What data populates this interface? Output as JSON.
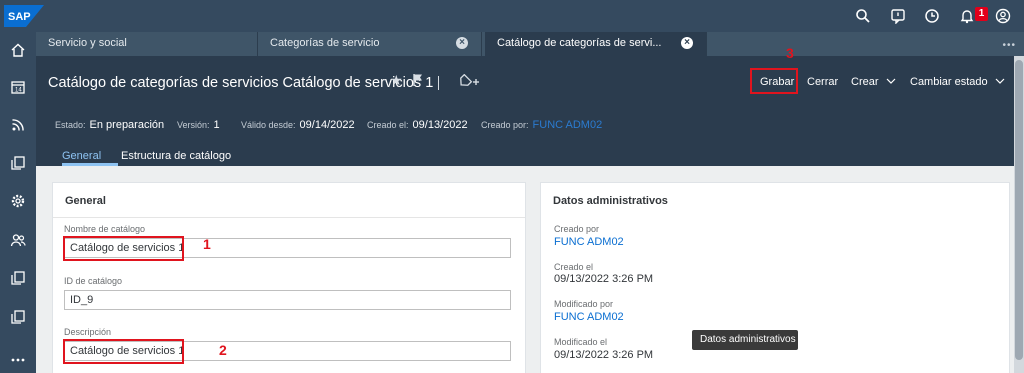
{
  "shell": {
    "logo_text": "SAP",
    "brand_color": "#0a6ed1",
    "icons": [
      "search-icon",
      "feedback-icon",
      "history-icon",
      "bell-icon",
      "user-icon"
    ],
    "notification_count": "1"
  },
  "sidenav": {
    "icons": [
      "home-icon",
      "calendar-icon",
      "feed-icon",
      "copy-icon",
      "settings-icon",
      "users-icon",
      "copy-icon",
      "copy-icon",
      "more-icon"
    ]
  },
  "tabs": [
    {
      "label": "Servicio y social"
    },
    {
      "label": "Categorías de servicio"
    },
    {
      "label": "Catálogo de categorías de servi..."
    }
  ],
  "header": {
    "title": "Catálogo de categorías de servicios Catálogo de servicios 1",
    "actions": {
      "save": "Grabar",
      "close": "Cerrar",
      "create": "Crear",
      "change_status": "Cambiar estado"
    },
    "meta": {
      "estado_label": "Estado:",
      "estado_value": "En preparación",
      "version_label": "Versión:",
      "version_value": "1",
      "valido_label": "Válido desde:",
      "valido_value": "09/14/2022",
      "creado_el_label": "Creado el:",
      "creado_el_value": "09/13/2022",
      "creado_por_label": "Creado por:",
      "creado_por_value": "FUNC ADM02"
    },
    "subtabs": [
      "General",
      "Estructura de catálogo"
    ]
  },
  "general": {
    "title": "General",
    "fields": {
      "nombre_label": "Nombre de catálogo",
      "nombre_value": "Catálogo de servicios 1",
      "id_label": "ID de catálogo",
      "id_value": "ID_9",
      "descripcion_label": "Descripción",
      "descripcion_value": "Catálogo de servicios 1"
    }
  },
  "admin": {
    "title": "Datos administrativos",
    "creado_por_label": "Creado por",
    "creado_por_value": "FUNC ADM02",
    "creado_el_label": "Creado el",
    "creado_el_value": "09/13/2022 3:26 PM",
    "modificado_por_label": "Modificado por",
    "modificado_por_value": "FUNC ADM02",
    "modificado_el_label": "Modificado el",
    "modificado_el_value": "09/13/2022 3:26 PM"
  },
  "tooltip": "Datos administrativos",
  "annotations": {
    "one": "1",
    "two": "2",
    "three": "3"
  },
  "colors": {
    "shell": "#354a5f",
    "header": "#2b3c4e",
    "annotation_red": "#e0141e",
    "link": "#0a6ed1"
  }
}
